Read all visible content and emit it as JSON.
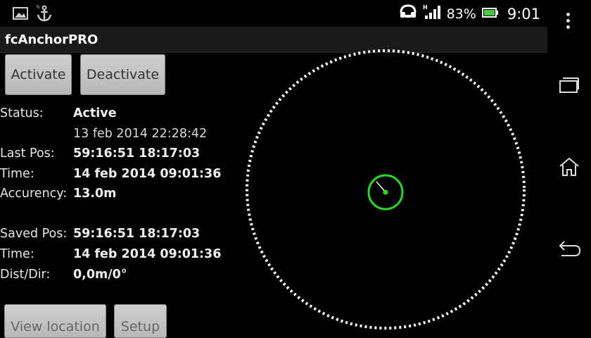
{
  "status_bar": {
    "battery_percent": "83%",
    "clock": "9:01",
    "icons": [
      "picture-icon",
      "anchor-icon",
      "headset-icon",
      "signal-h-icon",
      "battery-icon"
    ]
  },
  "app": {
    "title": "fcAnchorPRO"
  },
  "buttons": {
    "activate": "Activate",
    "deactivate": "Deactivate",
    "view_location": "View location",
    "setup": "Setup"
  },
  "info": {
    "status_label": "Status:",
    "status_value": "Active",
    "activated_time": "13 feb 2014 22:28:42",
    "last_pos_label": "Last Pos:",
    "last_pos_value": "59:16:51 18:17:03",
    "time_label": "Time:",
    "last_time_value": "14 feb 2014 09:01:36",
    "accuracy_label": "Accurency:",
    "accuracy_value": "13.0m",
    "saved_pos_label": "Saved Pos:",
    "saved_pos_value": "59:16:51 18:17:03",
    "saved_time_label": "Time:",
    "saved_time_value": "14 feb 2014 09:01:36",
    "dist_label": "Dist/Dir:",
    "dist_value": "0,0m/0°"
  },
  "colors": {
    "position_marker": "#22dd22",
    "boundary": "#ffffff",
    "background": "#000000"
  },
  "navbar": {
    "icons": [
      "overflow-menu-icon",
      "recent-apps-icon",
      "home-icon",
      "back-icon"
    ]
  }
}
